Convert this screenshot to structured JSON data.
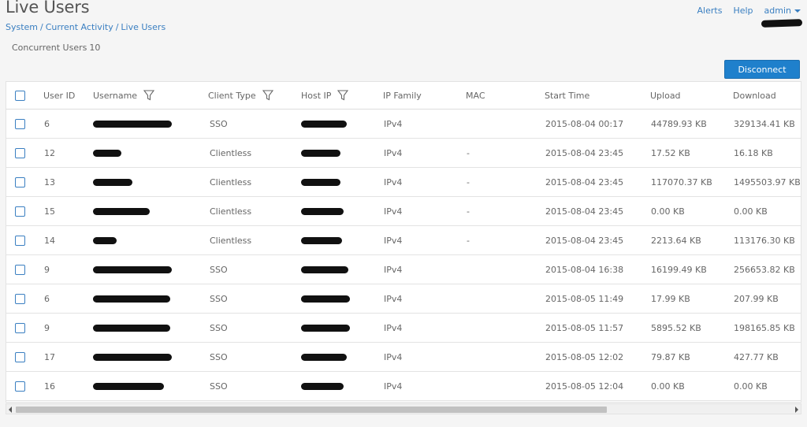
{
  "page": {
    "title": "Live Users",
    "breadcrumb": [
      "System",
      "Current Activity",
      "Live Users"
    ],
    "concurrent_label": "Concurrent Users",
    "concurrent_count": "10"
  },
  "top_links": {
    "alerts": "Alerts",
    "help": "Help",
    "admin": "admin"
  },
  "toolbar": {
    "disconnect_label": "Disconnect"
  },
  "columns": {
    "user_id": "User ID",
    "username": "Username",
    "client_type": "Client Type",
    "host_ip": "Host IP",
    "ip_family": "IP Family",
    "mac": "MAC",
    "start_time": "Start Time",
    "upload": "Upload",
    "download": "Download"
  },
  "rows": [
    {
      "user_id": "6",
      "client_type": "SSO",
      "ip_family": "IPv4",
      "mac": "",
      "start_time": "2015-08-04 00:17",
      "upload": "44789.93 KB",
      "download": "329134.41 KB"
    },
    {
      "user_id": "12",
      "client_type": "Clientless",
      "ip_family": "IPv4",
      "mac": "-",
      "start_time": "2015-08-04 23:45",
      "upload": "17.52 KB",
      "download": "16.18 KB"
    },
    {
      "user_id": "13",
      "client_type": "Clientless",
      "ip_family": "IPv4",
      "mac": "-",
      "start_time": "2015-08-04 23:45",
      "upload": "117070.37 KB",
      "download": "1495503.97 KB"
    },
    {
      "user_id": "15",
      "client_type": "Clientless",
      "ip_family": "IPv4",
      "mac": "-",
      "start_time": "2015-08-04 23:45",
      "upload": "0.00 KB",
      "download": "0.00 KB"
    },
    {
      "user_id": "14",
      "client_type": "Clientless",
      "ip_family": "IPv4",
      "mac": "-",
      "start_time": "2015-08-04 23:45",
      "upload": "2213.64 KB",
      "download": "113176.30 KB"
    },
    {
      "user_id": "9",
      "client_type": "SSO",
      "ip_family": "IPv4",
      "mac": "",
      "start_time": "2015-08-04 16:38",
      "upload": "16199.49 KB",
      "download": "256653.82 KB"
    },
    {
      "user_id": "6",
      "client_type": "SSO",
      "ip_family": "IPv4",
      "mac": "",
      "start_time": "2015-08-05 11:49",
      "upload": "17.99 KB",
      "download": "207.99 KB"
    },
    {
      "user_id": "9",
      "client_type": "SSO",
      "ip_family": "IPv4",
      "mac": "",
      "start_time": "2015-08-05 11:57",
      "upload": "5895.52 KB",
      "download": "198165.85 KB"
    },
    {
      "user_id": "17",
      "client_type": "SSO",
      "ip_family": "IPv4",
      "mac": "",
      "start_time": "2015-08-05 12:02",
      "upload": "79.87 KB",
      "download": "427.77 KB"
    },
    {
      "user_id": "16",
      "client_type": "SSO",
      "ip_family": "IPv4",
      "mac": "",
      "start_time": "2015-08-05 12:04",
      "upload": "0.00 KB",
      "download": "0.00 KB"
    }
  ],
  "colors": {
    "accent": "#1f80cc",
    "link": "#3a7fc1",
    "redaction": "#111111"
  }
}
